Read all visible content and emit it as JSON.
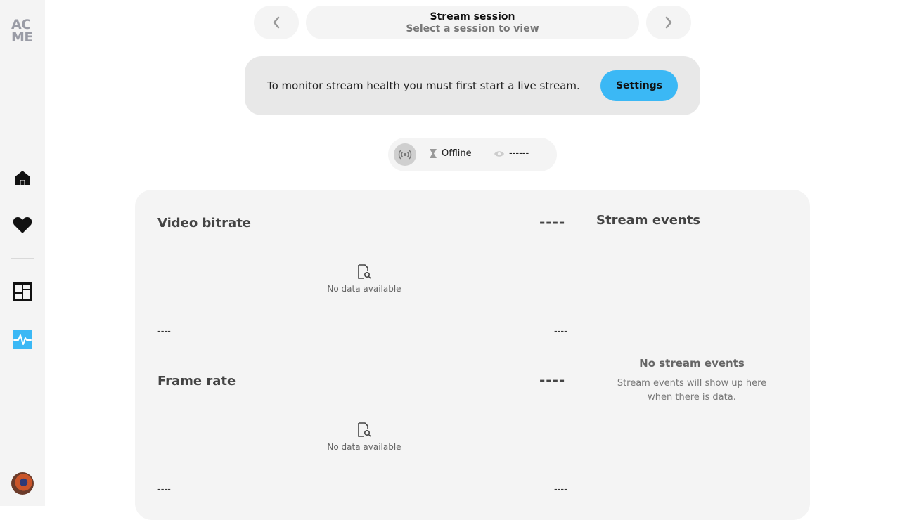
{
  "sidebar": {
    "logo_line1": "AC",
    "logo_line2": "ME",
    "items": [
      {
        "name": "home",
        "icon": "home-icon"
      },
      {
        "name": "favorites",
        "icon": "heart-icon"
      },
      {
        "name": "dashboard",
        "icon": "dashboard-icon"
      },
      {
        "name": "stream-health",
        "icon": "activity-icon",
        "active": true
      }
    ],
    "accent_color": "#3bb8f5"
  },
  "session_nav": {
    "title": "Stream session",
    "subtitle": "Select a session to view"
  },
  "notice": {
    "message": "To monitor stream health you must first start a live stream.",
    "button_label": "Settings"
  },
  "status": {
    "state": "Offline",
    "viewers": "------"
  },
  "panels": {
    "video_bitrate": {
      "title": "Video bitrate",
      "value": "----",
      "empty_text": "No data available",
      "axis_start": "----",
      "axis_end": "----"
    },
    "frame_rate": {
      "title": "Frame rate",
      "value": "----",
      "empty_text": "No data available",
      "axis_start": "----",
      "axis_end": "----"
    }
  },
  "events": {
    "title": "Stream events",
    "empty_title": "No stream events",
    "empty_line1": "Stream events will show up here",
    "empty_line2": "when there is data."
  }
}
